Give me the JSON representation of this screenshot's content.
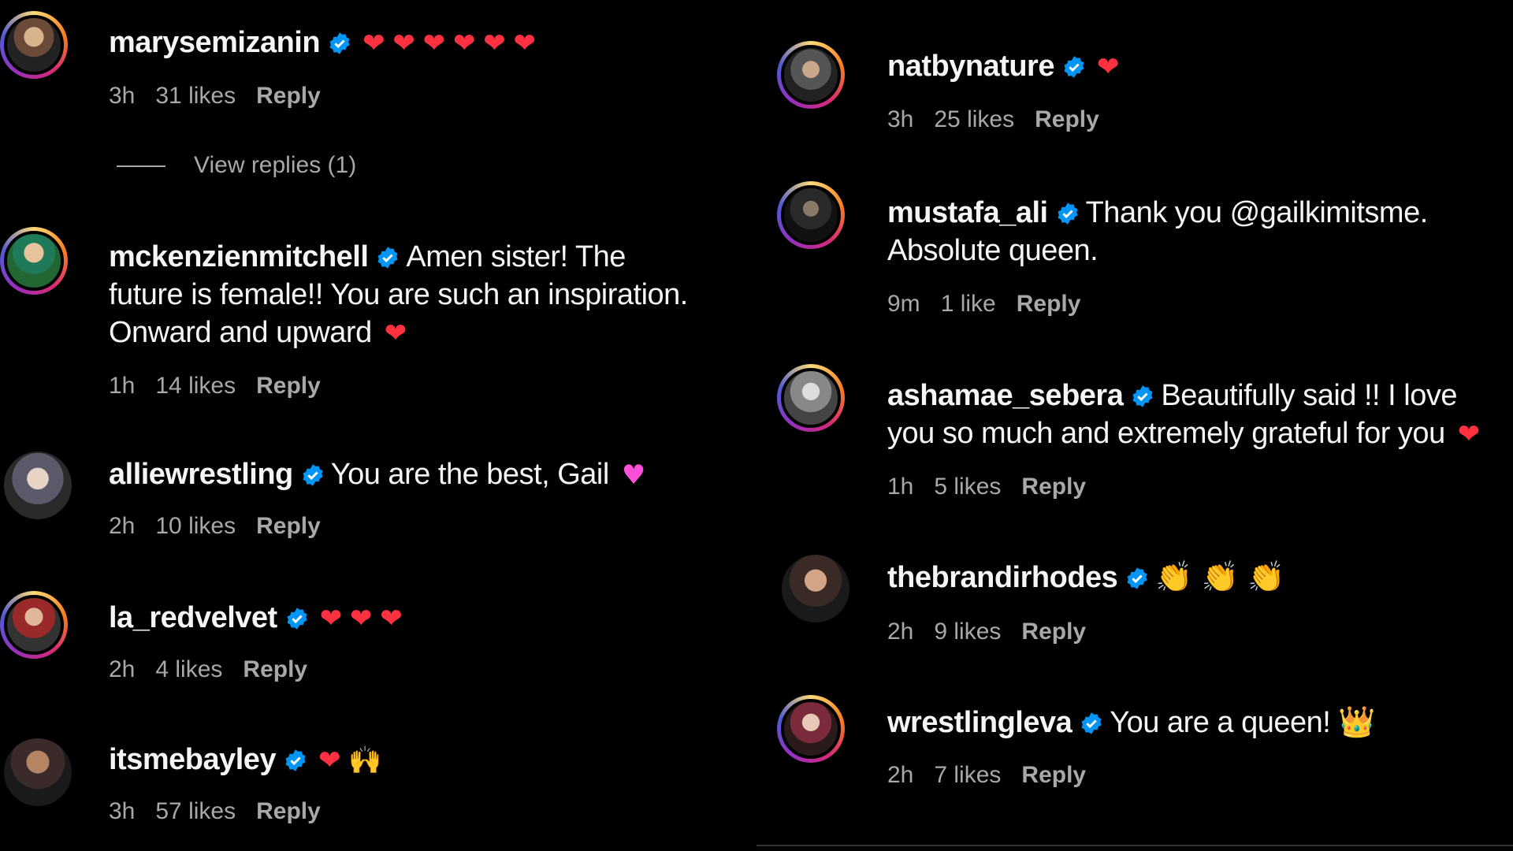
{
  "left_comments": [
    {
      "username": "marysemizanin",
      "text": "",
      "emoji": "❤ ❤ ❤ ❤ ❤ ❤",
      "time": "3h",
      "likes": "31 likes",
      "reply": "Reply",
      "view_replies": "View replies (1)"
    },
    {
      "username": "mckenzienmitchell",
      "text": "Amen sister! The future is female!! You are such an inspiration. Onward and upward",
      "emoji": "❤",
      "time": "1h",
      "likes": "14 likes",
      "reply": "Reply"
    },
    {
      "username": "alliewrestling",
      "text": "You are the best, Gail",
      "emoji": "♥",
      "time": "2h",
      "likes": "10 likes",
      "reply": "Reply"
    },
    {
      "username": "la_redvelvet",
      "text": "",
      "emoji": "❤ ❤ ❤",
      "time": "2h",
      "likes": "4 likes",
      "reply": "Reply"
    },
    {
      "username": "itsmebayley",
      "text": "",
      "emoji": "❤ 🙌",
      "time": "3h",
      "likes": "57 likes",
      "reply": "Reply"
    }
  ],
  "right_comments": [
    {
      "username": "natbynature",
      "text": "",
      "emoji": "❤",
      "time": "3h",
      "likes": "25 likes",
      "reply": "Reply"
    },
    {
      "username": "mustafa_ali",
      "text": "Thank you @gailkimitsme. Absolute queen.",
      "emoji": "",
      "time": "9m",
      "likes": "1 like",
      "reply": "Reply"
    },
    {
      "username": "ashamae_sebera",
      "text": "Beautifully said !! I love you so much and extremely grateful for you",
      "emoji": "❤",
      "time": "1h",
      "likes": "5 likes",
      "reply": "Reply"
    },
    {
      "username": "thebrandirhodes",
      "text": "",
      "emoji": "👏 👏 👏",
      "time": "2h",
      "likes": "9 likes",
      "reply": "Reply"
    },
    {
      "username": "wrestlingleva",
      "text": "You are a queen!",
      "emoji": "👑",
      "time": "2h",
      "likes": "7 likes",
      "reply": "Reply"
    }
  ],
  "colors": {
    "background": "#000000",
    "text": "#f5f5f5",
    "meta": "#a8a8a8",
    "verified": "#0095f6",
    "heart": "#ff3040"
  }
}
